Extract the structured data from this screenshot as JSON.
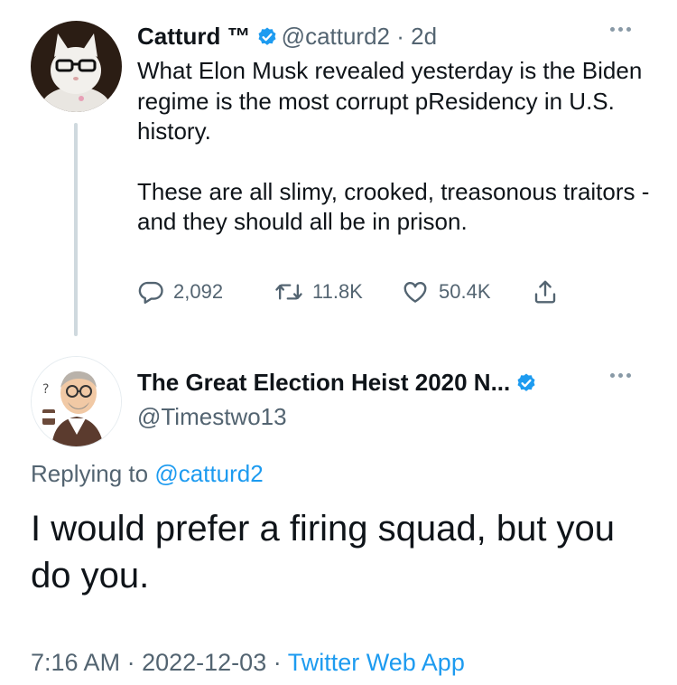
{
  "parent_tweet": {
    "display_name": "Catturd ™",
    "handle_time": "@catturd2 · 2d",
    "text_p1": "What Elon Musk revealed yesterday is the Biden regime is the most corrupt pResidency in U.S. history.",
    "text_p2": "These are all slimy, crooked, treasonous traitors - and they should all be in prison.",
    "replies": "2,092",
    "retweets": "11.8K",
    "likes": "50.4K"
  },
  "reply_tweet": {
    "display_name": "The Great Election Heist 2020 N...",
    "handle": "@Timestwo13",
    "replying_prefix": "Replying to",
    "replying_to": "@catturd2",
    "text": "I would prefer a firing squad, but you do you.",
    "time": "7:16 AM",
    "date": "2022-12-03",
    "separator": "·",
    "source": "Twitter Web App"
  },
  "icons": {
    "verified": "verified-badge-icon",
    "more": "more-dots-icon",
    "reply": "reply-icon",
    "retweet": "retweet-icon",
    "like": "heart-icon",
    "share": "share-icon"
  },
  "colors": {
    "accent": "#1d9bf0",
    "text": "#0f1419",
    "secondary": "#536471",
    "thread_line": "#cfd9de"
  }
}
